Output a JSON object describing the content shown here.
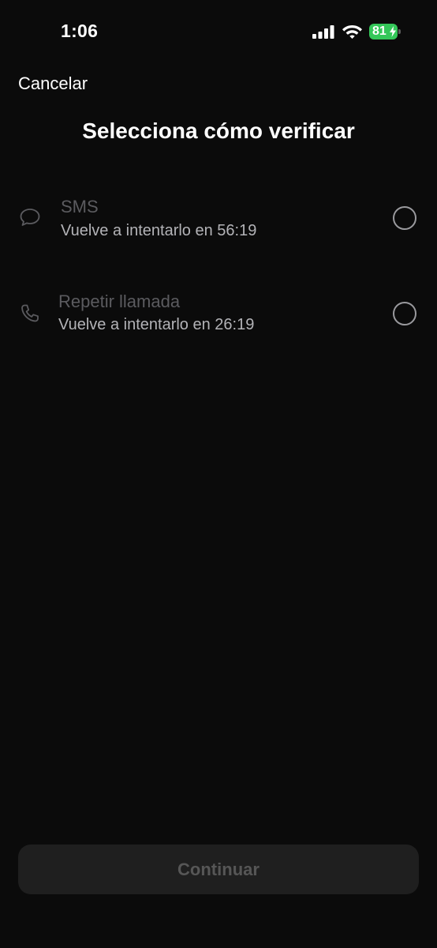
{
  "status_bar": {
    "time": "1:06",
    "battery_level": "81",
    "battery_color": "#34c759",
    "signal_icon": "cellular-signal-icon",
    "wifi_icon": "wifi-icon",
    "charging_icon": "bolt-icon"
  },
  "header": {
    "cancel_label": "Cancelar",
    "title": "Selecciona cómo verificar"
  },
  "options": [
    {
      "icon": "chat-bubble-icon",
      "title": "SMS",
      "subtitle": "Vuelve a intentarlo en 56:19",
      "selected": false
    },
    {
      "icon": "phone-icon",
      "title": "Repetir llamada",
      "subtitle": "Vuelve a intentarlo en 26:19",
      "selected": false
    }
  ],
  "footer": {
    "continue_label": "Continuar"
  }
}
